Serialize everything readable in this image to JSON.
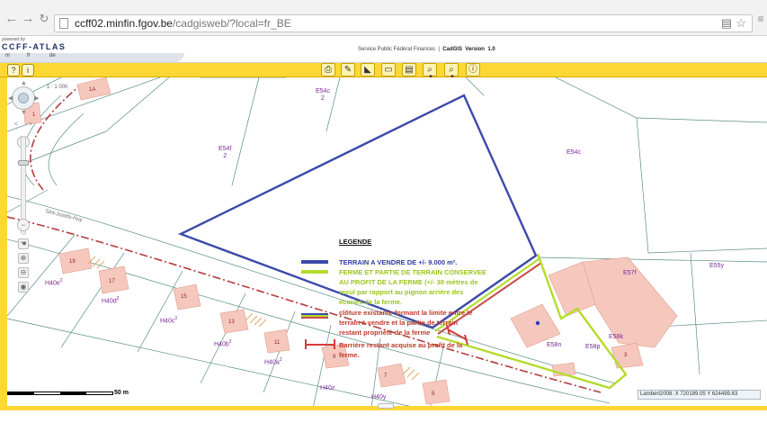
{
  "browser": {
    "back_icon": "back-arrow-icon",
    "forward_icon": "forward-arrow-icon",
    "url_host": "ccff02.minfin.fgov.be",
    "url_path": "/cadgisweb/?local=fr_BE"
  },
  "header": {
    "powered_by": "powered by",
    "brand": "CCFF-ATLAS",
    "lang_nl": "nl",
    "lang_fr": "fr",
    "lang_de": "de",
    "service": "Service Public Fédéral Finances",
    "app_name": "CadGIS",
    "version_label": "Version",
    "version": "1.0"
  },
  "map": {
    "scale_ratio": "1 : 1 000",
    "scale_label": "50 m",
    "coords": "Lambert2008:  X 720189.05  Y 624499.83",
    "street_label": "Sint-Jozefs-Huy",
    "colors": {
      "parcel_fill": "#f6c8bd",
      "parcel_stroke": "#e09a8a",
      "blue_terrain": "#3c4aa8",
      "green_farm": "#b4dc2c",
      "red_barrier": "#d63a3a",
      "toolbar": "#fdd835"
    },
    "parcel_labels": [
      {
        "text": "1A",
        "kind": "house"
      },
      {
        "text": "1",
        "kind": "house"
      },
      {
        "text": "E54c",
        "sub": "2",
        "kind": "parcel"
      },
      {
        "text": "E54f",
        "sub": "2",
        "kind": "parcel"
      },
      {
        "text": "E54c",
        "sub": "",
        "kind": "parcel"
      },
      {
        "text": "E57f",
        "sub": "",
        "kind": "parcel"
      },
      {
        "text": "E55y",
        "sub": "",
        "kind": "parcel"
      },
      {
        "text": "E58n",
        "sub": "",
        "kind": "parcel"
      },
      {
        "text": "E58p",
        "sub": "",
        "kind": "parcel"
      },
      {
        "text": "E58k",
        "sub": "",
        "kind": "parcel"
      },
      {
        "text": "H40e",
        "sup": "2",
        "kind": "parcel"
      },
      {
        "text": "H40d",
        "sup": "2",
        "kind": "parcel"
      },
      {
        "text": "H40c",
        "sup": "2",
        "kind": "parcel"
      },
      {
        "text": "H40b",
        "sup": "2",
        "kind": "parcel"
      },
      {
        "text": "H40a",
        "sup": "2",
        "kind": "parcel"
      },
      {
        "text": "H40z",
        "sup": "",
        "kind": "parcel"
      },
      {
        "text": "H40y",
        "sup": "",
        "kind": "parcel"
      },
      {
        "text": "19",
        "kind": "house"
      },
      {
        "text": "17",
        "kind": "house"
      },
      {
        "text": "15",
        "kind": "house"
      },
      {
        "text": "13",
        "kind": "house"
      },
      {
        "text": "11",
        "kind": "house"
      },
      {
        "text": "9",
        "kind": "house"
      },
      {
        "text": "7",
        "kind": "house"
      },
      {
        "text": "5",
        "kind": "house"
      },
      {
        "text": "3",
        "kind": "house"
      }
    ]
  },
  "legend": {
    "title": "LEGENDE",
    "terrain": "TERRAIN A VENDRE DE +/- 9.000 m².",
    "farm_1": "FERME ET PARTIE DE TERRAIN CONSERVEE",
    "farm_2": "AU PROFIT DE LA FERME (+/- 30 mètres de",
    "farm_3": "recul par rapport au pignon arrière des",
    "farm_4": "écuries de la ferme.",
    "fence_1": "clôture existante formant la limite entre le",
    "fence_2": "terrain à vendre et la partie de terrain",
    "fence_3": "restant propriété de la ferme",
    "barrier_1": "Barrière restant acquise au profit de la",
    "barrier_2": "ferme."
  }
}
